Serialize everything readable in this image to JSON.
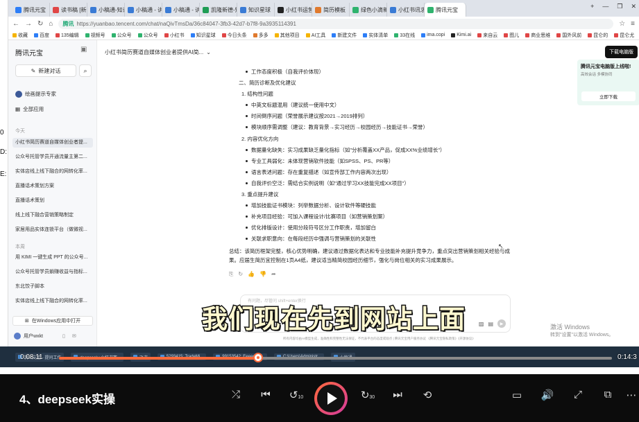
{
  "left_strip": [
    "0",
    "D:",
    "E:"
  ],
  "browser": {
    "tabs": [
      "腾讯元宝",
      "读书稿 [新",
      "小稿通-知识",
      "小稿通 - 讲",
      "小稿通 - 讲",
      "凯隆新德-知",
      "知识星球",
      "小红书运营",
      "简历模板",
      "绿色小滴新",
      "小红书讯求",
      "腾讯元宝"
    ],
    "active_tab": 11,
    "tab_ctrl": [
      "+",
      "—",
      "❐",
      "✕"
    ],
    "url_site": "腾讯",
    "url": "https://yuanbao.tencent.com/chat/naQivTmsDa/36c84047-3fb3-42d7-b7f8-9a3935114391",
    "bookmarks": [
      "收藏",
      "百度",
      "135编辑",
      "视频号",
      "公众号",
      "公众号",
      "小红书",
      "知识星球",
      "今日头条",
      "多多",
      "其他项目",
      "AI工具",
      "新建文件",
      "实体清单",
      "33在线",
      "ima.copi",
      "Kimi.ai",
      "来自云",
      "图儿",
      "商业思维",
      "国外风前",
      "昆仑的",
      "昆仑尤",
      "ICP备案"
    ]
  },
  "sidebar": {
    "brand": "腾讯元宝",
    "new_chat": "新建对话",
    "menu": [
      "绘画提示专家",
      "全部应用"
    ],
    "group_today": "今天",
    "today": [
      "小红书简历赛道自媒体创业者提...",
      "公众号托管学员开通流量主第二...",
      "实体店线上线下融合的网转化率...",
      "直播话术策划方案",
      "直播话术策划",
      "线上线下融合营销策略制定",
      "家居用品实体连锁平台（做微视..."
    ],
    "group_week": "本周",
    "week": [
      "用 KIMI 一键生成 PPT 的公众号...",
      "公众号托管学员躺赚收益与指标...",
      "东北饺子脚本",
      "实体店线上线下融合的网转化率..."
    ],
    "open_windows": "在Windows应用中打开",
    "user": "用户wxkt"
  },
  "main": {
    "title": "小红书简历赛道自媒体创业者提供AI简...",
    "download": "下载电脑版",
    "content": [
      {
        "k": "b",
        "t": "工作态度积极（自我评价体现）"
      },
      {
        "k": "l1",
        "t": "二、简历诊断及优化建议"
      },
      {
        "k": "l2",
        "t": "1. 结构性问题"
      },
      {
        "k": "b",
        "t": "中英文标题混用（建议统一使用中文）"
      },
      {
        "k": "b",
        "t": "时间倒序问题（荣誉展示建议按2021→2019排列）"
      },
      {
        "k": "b",
        "t": "模块顺序需调整（建议：教育背景→实习经历→校园经历→技能证书→荣誉）"
      },
      {
        "k": "l2",
        "t": "2. 内容优化方向"
      },
      {
        "k": "b",
        "t": "数据量化缺失：实习成果缺乏量化指标（如\"分析覆盖XX产品，促成XX%业绩增长\"）"
      },
      {
        "k": "b",
        "t": "专业工具弱化：未体现营销软件技能（如SPSS、PS、PR等）"
      },
      {
        "k": "b",
        "t": "语言表述问题：存在重复描述（如宣传部工作内容两次出现）"
      },
      {
        "k": "b",
        "t": "自我评价空泛：需结合实例说明（如\"通过学习XX技能完成XX项目\"）"
      },
      {
        "k": "l2",
        "t": "3. 重点提升建议"
      },
      {
        "k": "b",
        "t": "增加技能证书模块：列举数据分析、设计软件等硬技能"
      },
      {
        "k": "b",
        "t": "补充项目经验：可加入课程设计/比赛项目（如营销策划案）"
      },
      {
        "k": "b",
        "t": "优化排版设计：使用分段符号区分工作职责，增加留白"
      },
      {
        "k": "b",
        "t": "关联求职意向：在每段经历中强调与营销策划的关联性"
      }
    ],
    "summary": "总结：该简历框架完整，核心优势明确，建议通过数据化表达和专业技能补充提升竞争力，重点突出营销策划相关经验与成果。应届生简历宜控制在1页A4纸，建议适当精简校园经历细节，强化与岗位相关的实习成果展示。",
    "input_placeholder": "有问题，尽管问  shift+enter换行",
    "footnote": "所有内容均由AI模型生成，准确性和完整性无法保证，不代表平台的态度或观点 | 腾讯元宝用户服务协议 《腾讯元宝隐私政策》《开源协议》",
    "promo_title": "腾讯元宝电脑版上线啦!",
    "promo_sub": "高效会话  多模协同",
    "promo_btn": "立即下载",
    "watermark_title": "激活 Windows",
    "watermark_sub": "转到\"设置\"以激活 Windows。"
  },
  "subtitle": "我们现在先到网站上面",
  "taskbar": [
    "腾讯元宝 - 提问工作",
    "deepseek+小红书赛...",
    "飞书",
    "5293415: TradeMi...",
    "99153542: Eeeeeo-T...",
    "C:\\Users\\Administr...",
    "小稿通"
  ],
  "player": {
    "time_current": "0:08:11",
    "time_total": "0:14:3",
    "progress": 0.36,
    "title": "4、deepseek实操",
    "controls": [
      "shuffle-icon",
      "previous-icon",
      "rewind-10-icon",
      "play-icon",
      "forward-30-icon",
      "next-icon",
      "repeat-off-icon",
      "subtitles-icon",
      "volume-icon",
      "fullscreen-icon",
      "mini-player-icon",
      "more-icon"
    ],
    "accent": "#ff6a3a"
  }
}
